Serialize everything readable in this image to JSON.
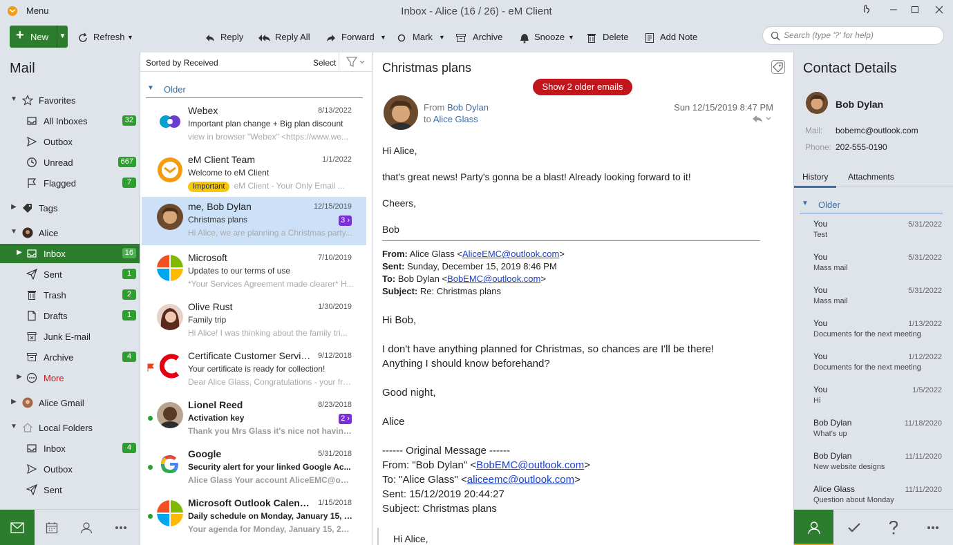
{
  "window": {
    "title": "Inbox - Alice (16 / 26) - eM Client",
    "menu_label": "Menu"
  },
  "toolbar": {
    "new_label": "New",
    "refresh_label": "Refresh",
    "reply_label": "Reply",
    "reply_all_label": "Reply All",
    "forward_label": "Forward",
    "mark_label": "Mark",
    "archive_label": "Archive",
    "snooze_label": "Snooze",
    "delete_label": "Delete",
    "add_note_label": "Add Note",
    "search_placeholder": "Search (type '?' for help)"
  },
  "sidebar": {
    "title": "Mail",
    "items": [
      {
        "label": "Favorites",
        "icon": "star-icon"
      },
      {
        "label": "All Inboxes",
        "badge": "32",
        "icon": "inbox-icon"
      },
      {
        "label": "Outbox",
        "icon": "outbox-icon"
      },
      {
        "label": "Unread",
        "badge": "667",
        "icon": "clock-icon"
      },
      {
        "label": "Flagged",
        "badge": "7",
        "icon": "flag-icon"
      },
      {
        "label": "Tags",
        "icon": "tag-icon"
      },
      {
        "label": "Alice",
        "icon": "avatar-icon"
      },
      {
        "label": "Inbox",
        "badge": "16",
        "icon": "inbox-icon"
      },
      {
        "label": "Sent",
        "badge": "1",
        "icon": "sent-icon"
      },
      {
        "label": "Trash",
        "badge": "2",
        "icon": "trash-icon"
      },
      {
        "label": "Drafts",
        "badge": "1",
        "icon": "draft-icon"
      },
      {
        "label": "Junk E-mail",
        "icon": "junk-icon"
      },
      {
        "label": "Archive",
        "badge": "4",
        "icon": "archive-icon"
      },
      {
        "label": "More",
        "icon": "more-icon"
      },
      {
        "label": "Alice Gmail",
        "icon": "avatar-icon"
      },
      {
        "label": "Local Folders",
        "icon": "home-icon"
      },
      {
        "label": "Inbox",
        "badge": "4",
        "icon": "inbox-icon"
      },
      {
        "label": "Outbox",
        "icon": "outbox-icon"
      },
      {
        "label": "Sent",
        "icon": "sent-icon"
      }
    ]
  },
  "message_list": {
    "sorted_label": "Sorted by Received",
    "select_label": "Select",
    "group_label": "Older",
    "messages": [
      {
        "from": "Webex",
        "date": "8/13/2022",
        "subject": "Important plan change + Big plan discount",
        "preview": "view in browser \"Webex\" <https://www.we..."
      },
      {
        "from": "eM Client Team",
        "date": "1/1/2022",
        "subject": "Welcome to eM Client",
        "tag": "Important",
        "preview": "eM Client - Your Only Email ..."
      },
      {
        "from": "me, Bob Dylan",
        "date": "12/15/2019",
        "subject": "Christmas plans",
        "thread_count": "3",
        "preview": "Hi Alice,  we are planning a Christmas party..."
      },
      {
        "from": "Microsoft",
        "date": "7/10/2019",
        "subject": "Updates to our terms of use",
        "preview": "*Your Services Agreement made clearer*  H..."
      },
      {
        "from": "Olive Rust",
        "date": "1/30/2019",
        "subject": "Family trip",
        "preview": "Hi Alice! I was thinking about the family tri..."
      },
      {
        "from": "Certificate Customer Servic...",
        "date": "9/12/2018",
        "subject": "Your certificate is ready for collection!",
        "preview": "Dear Alice Glass,  Congratulations - your fre..."
      },
      {
        "from": "Lionel Reed",
        "date": "8/23/2018",
        "subject": "Activation key",
        "thread_count": "2",
        "preview": "Thank you Mrs Glass it's nice not having t..."
      },
      {
        "from": "Google",
        "date": "5/31/2018",
        "subject": "Security alert for your linked Google Ac...",
        "preview": "Alice Glass   Your account AliceEMC@outl..."
      },
      {
        "from": "Microsoft Outlook Calend...",
        "date": "1/15/2018",
        "subject": "Daily schedule on Monday, January 15, 2...",
        "preview": "Your agenda for Monday, January 15, 201..."
      }
    ]
  },
  "reader": {
    "subject": "Christmas plans",
    "show_older": "Show 2 older emails",
    "from_prefix": "From",
    "from_name": "Bob Dylan",
    "to_prefix": "to",
    "to_name": "Alice Glass",
    "date": "Sun 12/15/2019 8:47 PM",
    "body": {
      "greeting": "Hi Alice,",
      "line1": "that's great news! Party's gonna be a blast! Already looking forward to it!",
      "closing": "Cheers,",
      "sign": "Bob",
      "q_from_label": "From:",
      "q_from_name": "Alice Glass <",
      "q_from_email": "AliceEMC@outlook.com",
      "q_from_end": ">",
      "q_sent_label": "Sent:",
      "q_sent": "Sunday, December 15, 2019 8:46 PM",
      "q_to_label": "To:",
      "q_to_name": "Bob Dylan <",
      "q_to_email": "BobEMC@outlook.com",
      "q_to_end": ">",
      "q_subject_label": "Subject:",
      "q_subject": "Re: Christmas plans",
      "q_greeting": "Hi Bob,",
      "q_line1": "I don't have anything planned for Christmas, so chances are I'll be there!",
      "q_line2": "Anything I should know beforehand?",
      "q_closing": "Good night,",
      "q_sign": "Alice",
      "orig_header": "------ Original Message ------",
      "orig_from_pre": "From: \"Bob Dylan\" <",
      "orig_from_email": "BobEMC@outlook.com",
      "orig_from_end": ">",
      "orig_to_pre": "To: \"Alice Glass\" <",
      "orig_to_email": "aliceemc@outlook.com",
      "orig_to_end": ">",
      "orig_sent": "Sent: 15/12/2019 20:44:27",
      "orig_subject": "Subject: Christmas plans",
      "orig_greeting": "Hi Alice,"
    }
  },
  "contact": {
    "title": "Contact Details",
    "name": "Bob Dylan",
    "mail_label": "Mail:",
    "mail": "bobemc@outlook.com",
    "phone_label": "Phone:",
    "phone": "202-555-0190",
    "tabs": [
      "History",
      "Attachments"
    ],
    "group_label": "Older",
    "history": [
      {
        "who": "You",
        "date": "5/31/2022",
        "subject": "Test"
      },
      {
        "who": "You",
        "date": "5/31/2022",
        "subject": "Mass mail"
      },
      {
        "who": "You",
        "date": "5/31/2022",
        "subject": "Mass mail"
      },
      {
        "who": "You",
        "date": "1/13/2022",
        "subject": "Documents for the next meeting"
      },
      {
        "who": "You",
        "date": "1/12/2022",
        "subject": "Documents for the next meeting"
      },
      {
        "who": "You",
        "date": "1/5/2022",
        "subject": "Hi"
      },
      {
        "who": "Bob Dylan",
        "date": "11/18/2020",
        "subject": "What's up"
      },
      {
        "who": "Bob Dylan",
        "date": "11/11/2020",
        "subject": "New website designs"
      },
      {
        "who": "Alice Glass",
        "date": "11/11/2020",
        "subject": "Question about Monday"
      }
    ]
  },
  "colors": {
    "accent_green": "#2d7d2f",
    "badge_green": "#2d9f2f",
    "selected_row": "#cce0f7",
    "older_button": "#c0161c",
    "thread_badge": "#7b2fd6",
    "important_tag": "#f6c70a",
    "link_blue": "#3a6ea5"
  }
}
